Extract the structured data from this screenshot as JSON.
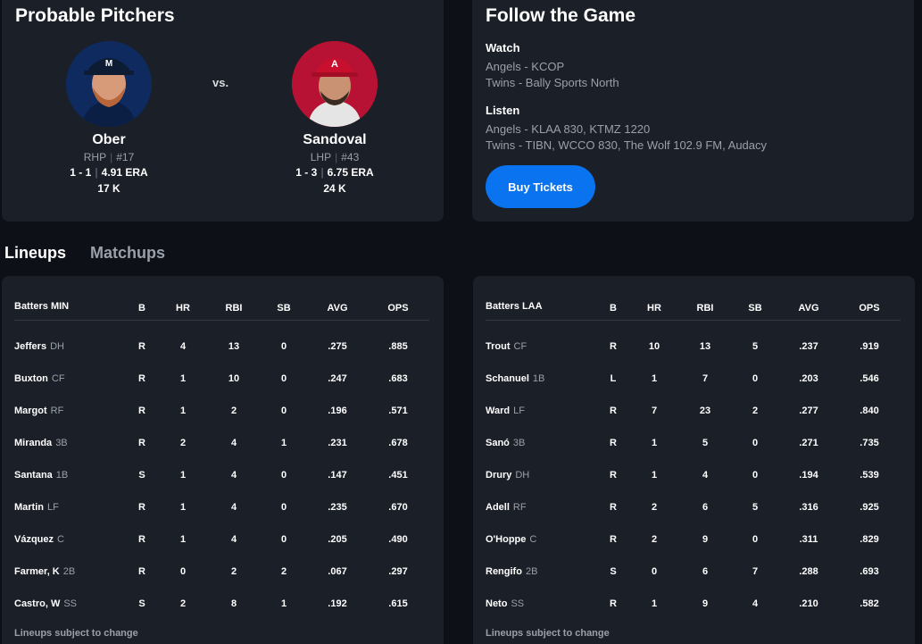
{
  "probable_pitchers": {
    "title": "Probable Pitchers",
    "vs": "vs.",
    "home": {
      "name": "Ober",
      "throws": "RHP",
      "number": "#17",
      "record": "1 - 1",
      "era": "4.91 ERA",
      "strikeouts": "17 K",
      "team_color": "#0e2a5e"
    },
    "away": {
      "name": "Sandoval",
      "throws": "LHP",
      "number": "#43",
      "record": "1 - 3",
      "era": "6.75 ERA",
      "strikeouts": "24 K",
      "team_color": "#b71234"
    }
  },
  "follow_game": {
    "title": "Follow the Game",
    "watch_heading": "Watch",
    "watch": [
      "Angels - KCOP",
      "Twins - Bally Sports North"
    ],
    "listen_heading": "Listen",
    "listen": [
      "Angels - KLAA 830, KTMZ 1220",
      "Twins - TIBN, WCCO 830, The Wolf 102.9 FM, Audacy"
    ],
    "buy_tickets": "Buy Tickets"
  },
  "tabs": {
    "lineups": "Lineups",
    "matchups": "Matchups"
  },
  "columns": [
    "B",
    "HR",
    "RBI",
    "SB",
    "AVG",
    "OPS"
  ],
  "lineups": [
    {
      "title": "Batters MIN",
      "players": [
        {
          "name": "Jeffers",
          "pos": "DH",
          "b": "R",
          "hr": "4",
          "rbi": "13",
          "sb": "0",
          "avg": ".275",
          "ops": ".885"
        },
        {
          "name": "Buxton",
          "pos": "CF",
          "b": "R",
          "hr": "1",
          "rbi": "10",
          "sb": "0",
          "avg": ".247",
          "ops": ".683"
        },
        {
          "name": "Margot",
          "pos": "RF",
          "b": "R",
          "hr": "1",
          "rbi": "2",
          "sb": "0",
          "avg": ".196",
          "ops": ".571"
        },
        {
          "name": "Miranda",
          "pos": "3B",
          "b": "R",
          "hr": "2",
          "rbi": "4",
          "sb": "1",
          "avg": ".231",
          "ops": ".678"
        },
        {
          "name": "Santana",
          "pos": "1B",
          "b": "S",
          "hr": "1",
          "rbi": "4",
          "sb": "0",
          "avg": ".147",
          "ops": ".451"
        },
        {
          "name": "Martin",
          "pos": "LF",
          "b": "R",
          "hr": "1",
          "rbi": "4",
          "sb": "0",
          "avg": ".235",
          "ops": ".670"
        },
        {
          "name": "Vázquez",
          "pos": "C",
          "b": "R",
          "hr": "1",
          "rbi": "4",
          "sb": "0",
          "avg": ".205",
          "ops": ".490"
        },
        {
          "name": "Farmer, K",
          "pos": "2B",
          "b": "R",
          "hr": "0",
          "rbi": "2",
          "sb": "2",
          "avg": ".067",
          "ops": ".297"
        },
        {
          "name": "Castro, W",
          "pos": "SS",
          "b": "S",
          "hr": "2",
          "rbi": "8",
          "sb": "1",
          "avg": ".192",
          "ops": ".615"
        }
      ],
      "note": "Lineups subject to change"
    },
    {
      "title": "Batters LAA",
      "players": [
        {
          "name": "Trout",
          "pos": "CF",
          "b": "R",
          "hr": "10",
          "rbi": "13",
          "sb": "5",
          "avg": ".237",
          "ops": ".919"
        },
        {
          "name": "Schanuel",
          "pos": "1B",
          "b": "L",
          "hr": "1",
          "rbi": "7",
          "sb": "0",
          "avg": ".203",
          "ops": ".546"
        },
        {
          "name": "Ward",
          "pos": "LF",
          "b": "R",
          "hr": "7",
          "rbi": "23",
          "sb": "2",
          "avg": ".277",
          "ops": ".840"
        },
        {
          "name": "Sanó",
          "pos": "3B",
          "b": "R",
          "hr": "1",
          "rbi": "5",
          "sb": "0",
          "avg": ".271",
          "ops": ".735"
        },
        {
          "name": "Drury",
          "pos": "DH",
          "b": "R",
          "hr": "1",
          "rbi": "4",
          "sb": "0",
          "avg": ".194",
          "ops": ".539"
        },
        {
          "name": "Adell",
          "pos": "RF",
          "b": "R",
          "hr": "2",
          "rbi": "6",
          "sb": "5",
          "avg": ".316",
          "ops": ".925"
        },
        {
          "name": "O'Hoppe",
          "pos": "C",
          "b": "R",
          "hr": "2",
          "rbi": "9",
          "sb": "0",
          "avg": ".311",
          "ops": ".829"
        },
        {
          "name": "Rengifo",
          "pos": "2B",
          "b": "S",
          "hr": "0",
          "rbi": "6",
          "sb": "7",
          "avg": ".288",
          "ops": ".693"
        },
        {
          "name": "Neto",
          "pos": "SS",
          "b": "R",
          "hr": "1",
          "rbi": "9",
          "sb": "4",
          "avg": ".210",
          "ops": ".582"
        }
      ],
      "note": "Lineups subject to change"
    }
  ]
}
